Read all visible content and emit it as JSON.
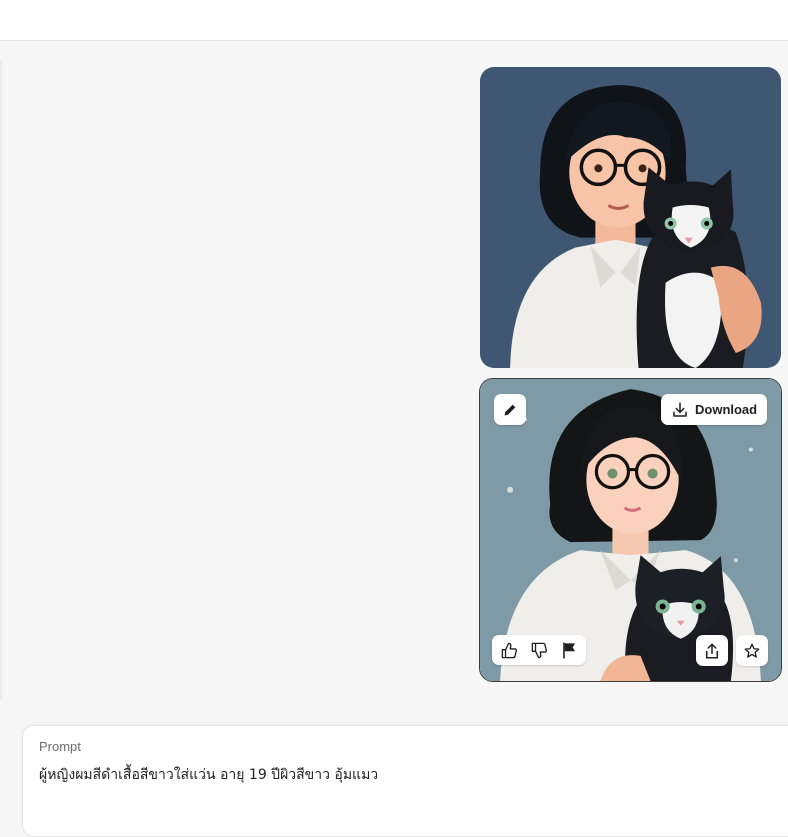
{
  "header": {},
  "images": [
    {
      "alt_icon": "portrait-woman-glasses-cat-1",
      "background_color": "#3f5772"
    },
    {
      "alt_icon": "portrait-woman-glasses-cat-2",
      "background_color": "#7d9aa6",
      "edit_icon": "pencil-icon",
      "download_label": "Download",
      "download_icon": "download-icon",
      "feedback_icons": [
        "thumbs-up-icon",
        "thumbs-down-icon",
        "flag-icon"
      ],
      "share_icon": "share-icon",
      "favorite_icon": "star-icon"
    }
  ],
  "prompt": {
    "label": "Prompt",
    "text": "ผู้หญิงผมสีดำเสื้อสีขาวใส่แว่น อายุ 19 ปีผิวสีขาว อุ้มแมว"
  },
  "colors": {
    "page_bg": "#f7f7f7",
    "card_border": "#3b3b3b",
    "button_bg": "#ffffff"
  }
}
